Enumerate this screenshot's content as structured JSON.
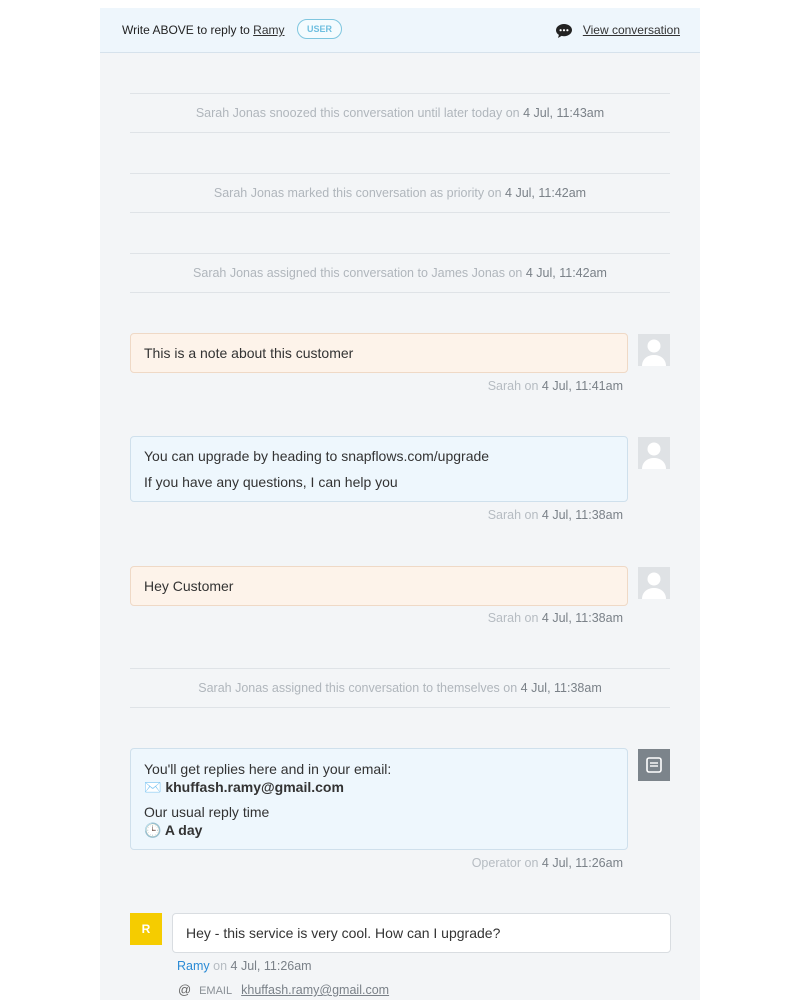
{
  "topbar": {
    "reply_prefix": "Write ABOVE to reply to",
    "reply_name": "Ramy",
    "badge": "USER",
    "view_conversation": "View conversation"
  },
  "events": [
    {
      "text": "Sarah Jonas snoozed this conversation until later today on",
      "time": "4 Jul, 11:43am"
    },
    {
      "text": "Sarah Jonas marked this conversation as priority on",
      "time": "4 Jul, 11:42am"
    },
    {
      "text": "Sarah Jonas assigned this conversation to James Jonas on",
      "time": "4 Jul, 11:42am"
    },
    {
      "text": "Sarah Jonas assigned this conversation to themselves on",
      "time": "4 Jul, 11:38am"
    }
  ],
  "messages": [
    {
      "lines": [
        "This is a note about this customer"
      ],
      "author": "Sarah",
      "on": "on",
      "time": "4 Jul, 11:41am"
    },
    {
      "lines": [
        "You can upgrade by heading to snapflows.com/upgrade",
        "If you have any questions, I can help you"
      ],
      "author": "Sarah",
      "on": "on",
      "time": "4 Jul, 11:38am"
    },
    {
      "lines": [
        "Hey Customer"
      ],
      "author": "Sarah",
      "on": "on",
      "time": "4 Jul, 11:38am"
    }
  ],
  "operator": {
    "line1": "You'll get replies here and in your email:",
    "email_emoji": "✉️",
    "email": "khuffash.ramy@gmail.com",
    "line3": "Our usual reply time",
    "clock_emoji": "🕒",
    "reply_time": "A day",
    "author": "Operator",
    "on": "on",
    "time": "4 Jul, 11:26am"
  },
  "customer": {
    "initial": "R",
    "text": "Hey - this service is very cool. How can I upgrade?",
    "author": "Ramy",
    "on": "on",
    "time": "4 Jul, 11:26am",
    "email_label": "EMAIL",
    "email": "khuffash.ramy@gmail.com"
  },
  "colors": {
    "avatar_yellow": "#f5cc00",
    "operator_gray": "#7c848b",
    "link_blue": "#2b8bd6"
  }
}
